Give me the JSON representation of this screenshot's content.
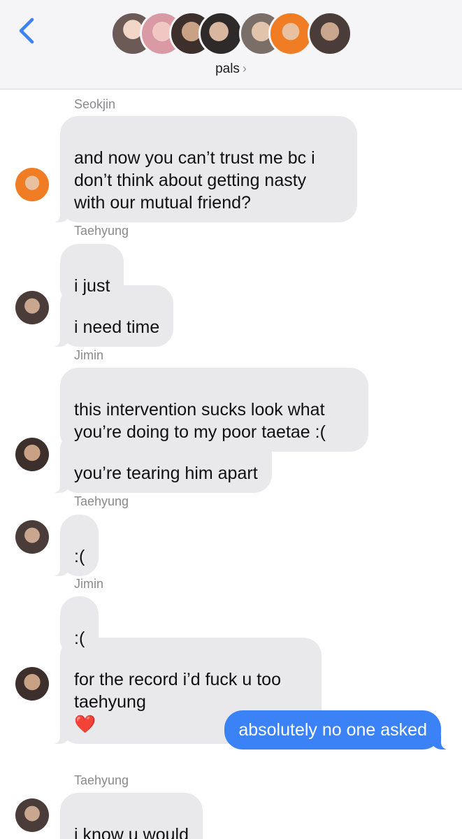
{
  "header": {
    "group_name": "pals",
    "chevron": "›",
    "back_icon": "chevron-left-icon",
    "accent_color": "#3b82f6",
    "member_avatars": [
      "avatar-1",
      "avatar-2",
      "avatar-3",
      "avatar-4",
      "avatar-5",
      "avatar-6",
      "avatar-7"
    ]
  },
  "messages": [
    {
      "sender": "Seokjin"
    },
    {
      "text": "and now you can’t trust me bc i\ndon’t think about getting nasty\nwith our mutual friend?"
    },
    {
      "sender": "Taehyung"
    },
    {
      "text": "i just"
    },
    {
      "text": "i need time"
    },
    {
      "sender": "Jimin"
    },
    {
      "text": "this intervention sucks look what\nyou’re doing to my poor taetae :("
    },
    {
      "text": "you’re tearing him apart"
    },
    {
      "sender": "Taehyung"
    },
    {
      "text": ":("
    },
    {
      "sender": "Jimin"
    },
    {
      "text": ":("
    },
    {
      "text": "for the record i’d fuck u too\ntaehyung",
      "emoji": "❤️"
    },
    {
      "text": "absolutely no one asked"
    },
    {
      "sender": "Taehyung"
    },
    {
      "text": "i know u would",
      "emoji": "❤️❤️"
    }
  ],
  "colors": {
    "incoming_bubble": "#e9e9eb",
    "outgoing_bubble": "#3b82f6",
    "sender_label": "#8a8a8e"
  }
}
